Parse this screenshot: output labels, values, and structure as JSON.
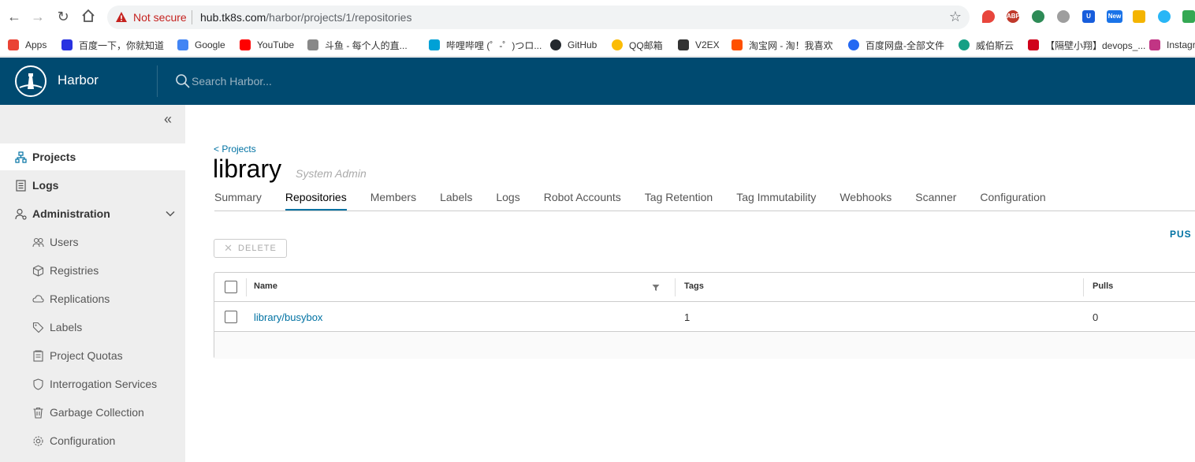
{
  "browser": {
    "not_secure": "Not secure",
    "url_host": "hub.tk8s.com",
    "url_path": "/harbor/projects/1/repositories",
    "bookmarks": [
      {
        "label": "Apps",
        "color": "#ea4335"
      },
      {
        "label": "百度一下，你就知道",
        "color": "#2932e1"
      },
      {
        "label": "Google",
        "color": "#4285f4"
      },
      {
        "label": "YouTube",
        "color": "#ff0000"
      },
      {
        "label": "斗鱼 - 每个人的直...",
        "color": "#888888"
      },
      {
        "label": "哔哩哔哩 (゜-゜)つロ...",
        "color": "#00a1d6"
      },
      {
        "label": "GitHub",
        "color": "#24292e"
      },
      {
        "label": "QQ邮箱",
        "color": "#fbbc05"
      },
      {
        "label": "V2EX",
        "color": "#333333"
      },
      {
        "label": "淘宝网 - 淘！我喜欢",
        "color": "#ff5000"
      },
      {
        "label": "百度网盘-全部文件",
        "color": "#2468f2"
      },
      {
        "label": "威伯斯云",
        "color": "#16a085"
      },
      {
        "label": "【隔壁小翔】devops_...",
        "color": "#d0021b"
      },
      {
        "label": "Instagr",
        "color": "#c13584"
      }
    ]
  },
  "header": {
    "brand": "Harbor",
    "search_placeholder": "Search Harbor..."
  },
  "sidebar": {
    "items": [
      {
        "label": "Projects",
        "icon": "projects-icon"
      },
      {
        "label": "Logs",
        "icon": "logs-icon"
      },
      {
        "label": "Administration",
        "icon": "administration-icon"
      }
    ],
    "admin_items": [
      {
        "label": "Users",
        "icon": "users-icon"
      },
      {
        "label": "Registries",
        "icon": "registries-icon"
      },
      {
        "label": "Replications",
        "icon": "replications-icon"
      },
      {
        "label": "Labels",
        "icon": "labels-icon"
      },
      {
        "label": "Project Quotas",
        "icon": "project-quotas-icon"
      },
      {
        "label": "Interrogation Services",
        "icon": "interrogation-services-icon"
      },
      {
        "label": "Garbage Collection",
        "icon": "garbage-collection-icon"
      },
      {
        "label": "Configuration",
        "icon": "configuration-icon"
      }
    ]
  },
  "project": {
    "back_link": "< Projects",
    "name": "library",
    "role": "System Admin",
    "tabs": [
      "Summary",
      "Repositories",
      "Members",
      "Labels",
      "Logs",
      "Robot Accounts",
      "Tag Retention",
      "Tag Immutability",
      "Webhooks",
      "Scanner",
      "Configuration"
    ],
    "active_tab": "Repositories"
  },
  "toolbar": {
    "delete_label": "DELETE",
    "push_label": "PUS"
  },
  "table": {
    "columns": [
      "Name",
      "Tags",
      "Pulls"
    ],
    "rows": [
      {
        "name": "library/busybox",
        "tags": "1",
        "pulls": "0"
      }
    ]
  },
  "colors": {
    "header_bg": "#004a70",
    "accent": "#0072a3",
    "sidebar_bg": "#eeeeee"
  }
}
